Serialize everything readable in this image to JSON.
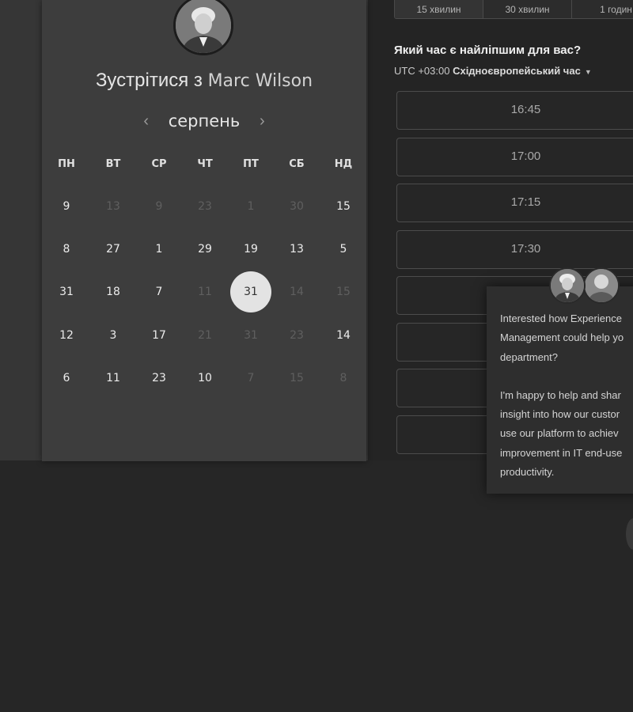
{
  "duration_tabs": [
    {
      "label": "15 хвилин",
      "active": true
    },
    {
      "label": "30 хвилин",
      "active": false
    },
    {
      "label": "1 годин",
      "active": false
    }
  ],
  "booking": {
    "title_prefix": "Зустрітися з",
    "host_name": "Marc Wilson",
    "month": "серпень",
    "prev_icon": "chevron-left-icon",
    "next_icon": "chevron-right-icon"
  },
  "weekdays": [
    "ПН",
    "ВТ",
    "СР",
    "ЧТ",
    "ПТ",
    "СБ",
    "НД"
  ],
  "weeks": [
    [
      {
        "d": "9",
        "m": false
      },
      {
        "d": "13",
        "m": true
      },
      {
        "d": "9",
        "m": true
      },
      {
        "d": "23",
        "m": true
      },
      {
        "d": "1",
        "m": true
      },
      {
        "d": "30",
        "m": true
      },
      {
        "d": "15",
        "m": false
      }
    ],
    [
      {
        "d": "8",
        "m": false
      },
      {
        "d": "27",
        "m": false
      },
      {
        "d": "1",
        "m": false
      },
      {
        "d": "29",
        "m": false
      },
      {
        "d": "19",
        "m": false
      },
      {
        "d": "13",
        "m": false
      },
      {
        "d": "5",
        "m": false
      }
    ],
    [
      {
        "d": "31",
        "m": false
      },
      {
        "d": "18",
        "m": false
      },
      {
        "d": "7",
        "m": false
      },
      {
        "d": "11",
        "m": true
      },
      {
        "d": "31",
        "m": false,
        "selected": true
      },
      {
        "d": "14",
        "m": true
      },
      {
        "d": "15",
        "m": true
      }
    ],
    [
      {
        "d": "12",
        "m": false
      },
      {
        "d": "3",
        "m": false
      },
      {
        "d": "17",
        "m": false
      },
      {
        "d": "21",
        "m": true
      },
      {
        "d": "31",
        "m": true
      },
      {
        "d": "23",
        "m": true
      },
      {
        "d": "14",
        "m": false
      }
    ],
    [
      {
        "d": "6",
        "m": false
      },
      {
        "d": "11",
        "m": false
      },
      {
        "d": "23",
        "m": false
      },
      {
        "d": "10",
        "m": false
      },
      {
        "d": "7",
        "m": true
      },
      {
        "d": "15",
        "m": true
      },
      {
        "d": "8",
        "m": true
      }
    ]
  ],
  "time_picker": {
    "question": "Який час є найліпшим для вас?",
    "tz_offset": "UTC +03:00",
    "tz_name": "Східноєвропейський час",
    "slots": [
      "16:45",
      "17:00",
      "17:15",
      "17:30",
      "",
      "",
      "",
      ""
    ]
  },
  "chat": {
    "paragraphs": [
      [
        "Interested how Experience",
        "Management could help yo",
        "department?"
      ],
      [
        "I'm happy to help and shar",
        "insight into how our custor",
        "use our platform to achiev",
        "improvement in IT end-use",
        "productivity."
      ]
    ]
  },
  "colors": {
    "selected_day_bg": "#e3e3e3",
    "card_bg": "#3d3d3d",
    "panel_bg": "#242424"
  }
}
